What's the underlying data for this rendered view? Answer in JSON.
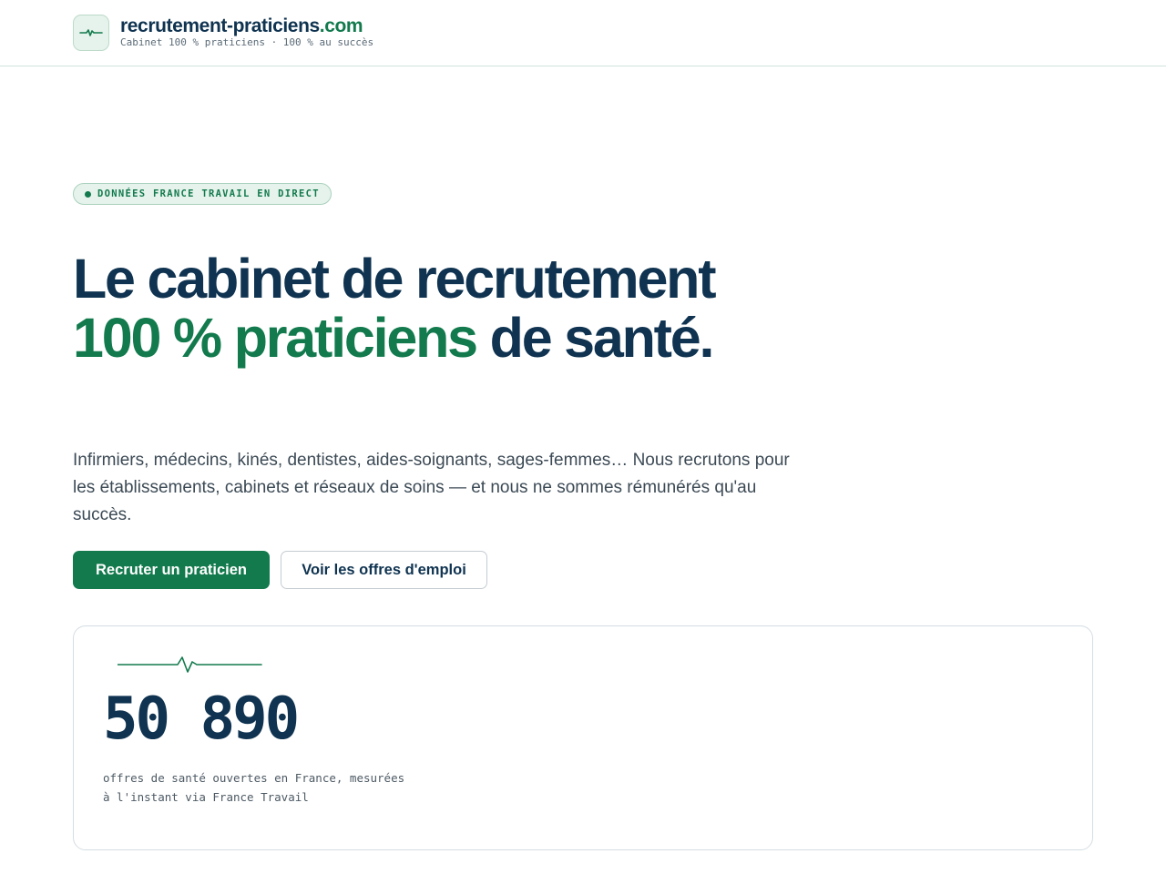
{
  "header": {
    "brand_name": "recrutement-praticiens",
    "brand_tld": ".com",
    "tagline": "Cabinet 100 % praticiens · 100 % au succès",
    "logo_icon": "heartbeat-icon"
  },
  "hero": {
    "badge": "DONNÉES FRANCE TRAVAIL EN DIRECT",
    "title_part1": "Le cabinet de recrutement ",
    "title_highlight": "100 % praticiens",
    "title_part2": " de santé.",
    "lead": "Infirmiers, médecins, kinés, dentistes, aides-soignants, sages-femmes… Nous recrutons pour les établissements, cabinets et réseaux de soins — et nous ne sommes rémunérés qu'au succès.",
    "primary_button": "Recruter un praticien",
    "secondary_button": "Voir les offres d'emploi"
  },
  "stat": {
    "value": "50 890",
    "description_line1": "offres de santé ouvertes en France, mesurées",
    "description_line2": "à l'instant via France Travail",
    "icon": "pulse-line-icon"
  },
  "colors": {
    "navy": "#0f3350",
    "green": "#127a4d",
    "light_green": "#e6f3ec",
    "text_muted": "#3c4a55"
  }
}
